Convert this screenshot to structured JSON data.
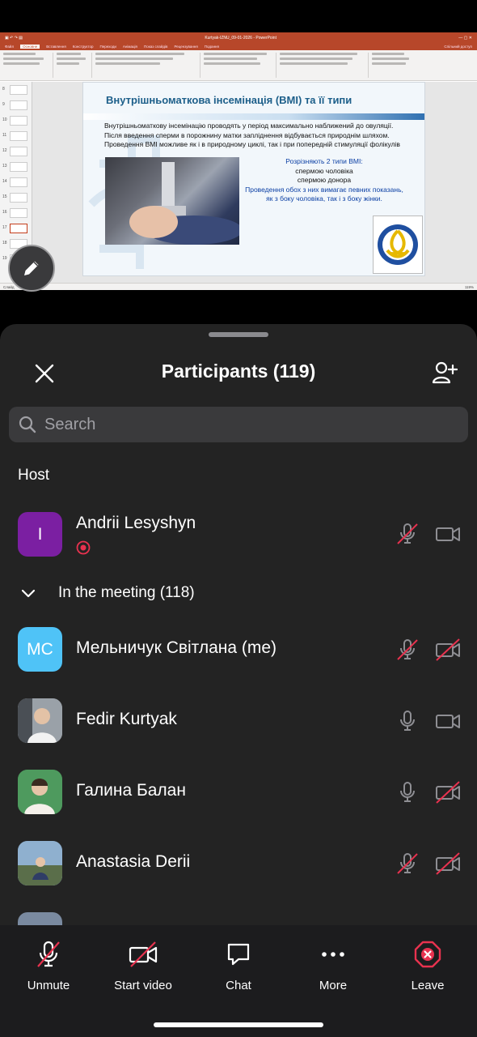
{
  "screen_share": {
    "window_title": "Kurtyak-IZNU_09-01-2026 - PowerPoint",
    "ribbon_tabs": [
      "Файл",
      "Основне",
      "Вставлення",
      "Конструктор",
      "Переходи",
      "Анімація",
      "Показ слайдів",
      "Рецензування",
      "Подання"
    ],
    "share_label": "Спільний доступ",
    "slide_numbers": [
      "8",
      "9",
      "10",
      "11",
      "12",
      "13",
      "14",
      "15",
      "16",
      "17",
      "18",
      "19"
    ],
    "status_left": "Слайд",
    "status_right": "119%",
    "slide": {
      "title": "Внутрішньоматкова інсемінація (ВМІ) та її типи",
      "paragraph_lines": [
        "Внутрішньоматкову інсемінацію проводять у період максимально наближений до овуляції.",
        "Після введення сперми в порожнину матки запліднення відбувається природнім шляхом.",
        "Проведення ВМІ можливе як і в природному циклі, так і при попередній стимуляції фолікулів"
      ],
      "types_heading": "Розрізняють 2 типи ВМІ:",
      "type_1": "спермою чоловіка",
      "type_2": "спермою донора",
      "note": "Проведення обох з них вимагає певних показань, як з боку чоловіка, так і з боку жінки."
    }
  },
  "participants_panel": {
    "title": "Participants (119)",
    "search_placeholder": "Search",
    "host_section": "Host",
    "meeting_section": "In the meeting (118)",
    "host": {
      "name": "Andrii Lesyshyn",
      "initial": "I",
      "avatar_color": "#7b1fa2",
      "muted": true,
      "video_on": false,
      "recording": true
    },
    "members": [
      {
        "name": "Мельничук Світлана (me)",
        "initials": "MC",
        "avatar_color": "#4fc3f7",
        "muted": true,
        "video_off": true
      },
      {
        "name": "Fedir Kurtyak",
        "initials": "",
        "avatar_color": "#8a8f96",
        "muted": false,
        "video_off": false
      },
      {
        "name": "Галина Балан",
        "initials": "",
        "avatar_color": "#3b8a4f",
        "muted": false,
        "video_off": true
      },
      {
        "name": "Anastasia Derii",
        "initials": "",
        "avatar_color": "#6d8fb0",
        "muted": true,
        "video_off": true
      }
    ]
  },
  "toolbar": {
    "unmute": "Unmute",
    "start_video": "Start video",
    "chat": "Chat",
    "more": "More",
    "leave": "Leave"
  },
  "colors": {
    "accent_red": "#e8324f",
    "panel_bg": "#232323",
    "toolbar_bg": "#1c1c1e"
  }
}
